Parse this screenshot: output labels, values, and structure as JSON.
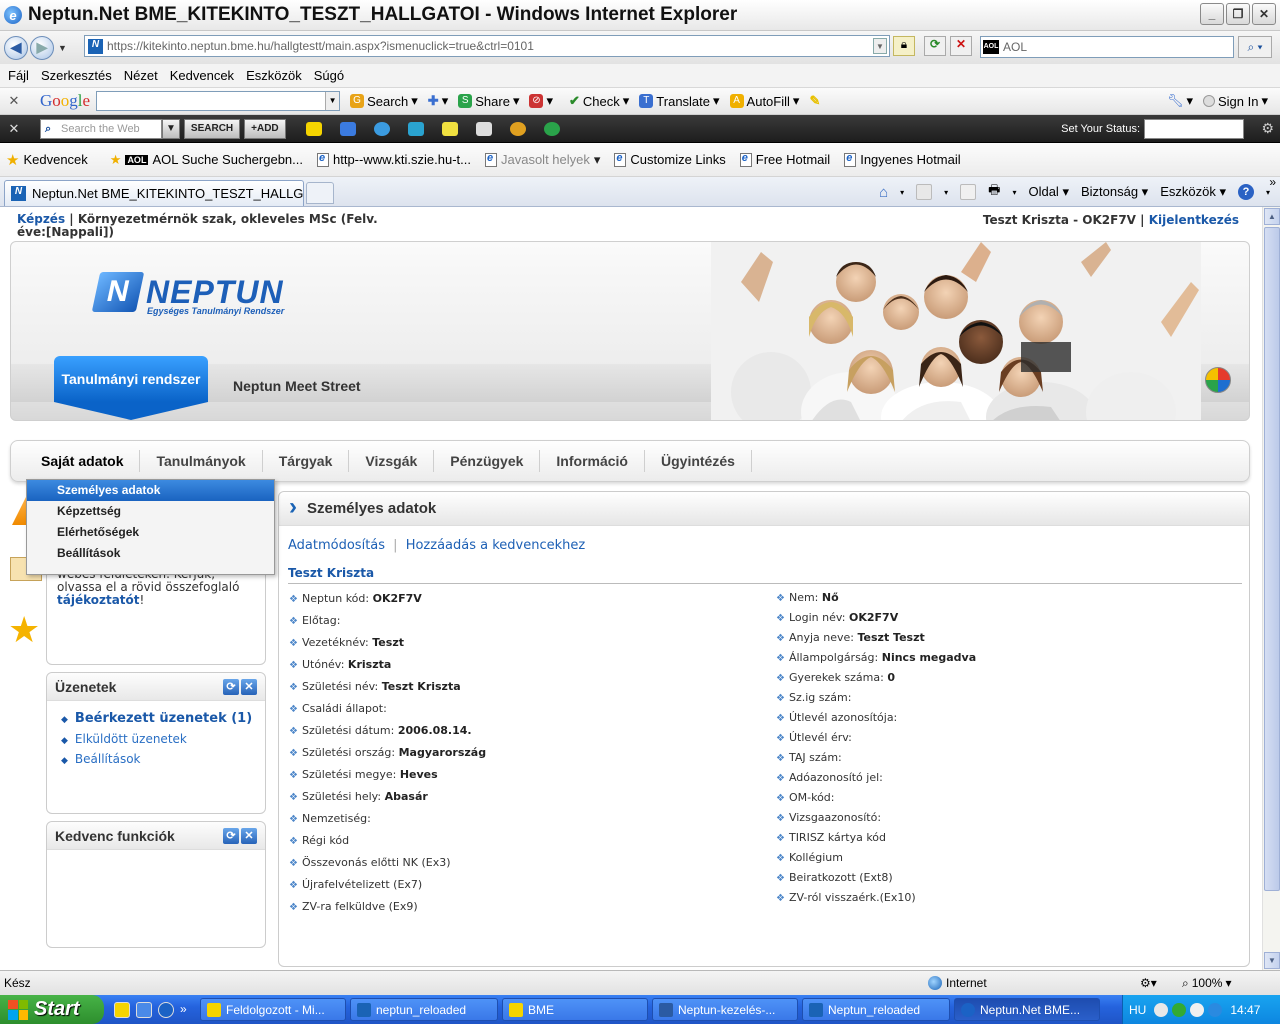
{
  "window": {
    "title": "Neptun.Net BME_KITEKINTO_TESZT_HALLGATOI - Windows Internet Explorer"
  },
  "address": {
    "url": "https://kitekinto.neptun.bme.hu/hallgtestt/main.aspx?ismenuclick=true&ctrl=0101",
    "aol_search": "AOL"
  },
  "menubar": [
    "Fájl",
    "Szerkesztés",
    "Nézet",
    "Kedvencek",
    "Eszközök",
    "Súgó"
  ],
  "google_toolbar": {
    "search": "Search",
    "share": "Share",
    "check": "Check",
    "translate": "Translate",
    "autofill": "AutoFill",
    "signin": "Sign In"
  },
  "aol_toolbar": {
    "placeholder": "Search the Web",
    "search_btn": "SEARCH",
    "add_btn": "+ADD",
    "status_label": "Set Your Status:"
  },
  "favbar": {
    "favorites": "Kedvencek",
    "items": [
      "AOL Suche Suchergebn...",
      "http--www.kti.szie.hu-t...",
      "Javasolt helyek",
      "Customize Links",
      "Free Hotmail",
      "Ingyenes Hotmail"
    ]
  },
  "tab": {
    "label": "Neptun.Net BME_KITEKINTO_TESZT_HALLGA..."
  },
  "cmdbar": {
    "page": "Oldal",
    "safety": "Biztonság",
    "tools": "Eszközök"
  },
  "top": {
    "training": "Képzés",
    "program": "Környezetmérnök szak, okleveles MSc (Felv. éve:[Nappali])",
    "user": "Teszt Kriszta - OK2F7V",
    "logout": "Kijelentkezés"
  },
  "header": {
    "logo_text": "NEPTUN",
    "logo_sub": "Egységes Tanulmányi Rendszer",
    "system_btn": "Tanulmányi rendszer",
    "meet": "Neptun Meet Street"
  },
  "nav": [
    "Saját adatok",
    "Tanulmányok",
    "Tárgyak",
    "Vizsgák",
    "Pénzügyek",
    "Információ",
    "Ügyintézés"
  ],
  "dropdown": [
    "Személyes adatok",
    "Képzettség",
    "Elérhetőségek",
    "Beállítások"
  ],
  "notice": {
    "line1": "webes felületeken. Kérjük,",
    "line2": "olvassa el a rövid összefoglaló",
    "link": "tájékoztatót",
    "tail": "!"
  },
  "messages": {
    "title": "Üzenetek",
    "inbox": "Beérkezett üzenetek (1)",
    "sent": "Elküldött üzenetek",
    "settings": "Beállítások"
  },
  "favfunc": {
    "title": "Kedvenc funkciók"
  },
  "main": {
    "title": "Személyes adatok",
    "action_edit": "Adatmódosítás",
    "action_fav": "Hozzáadás a kedvencekhez",
    "name": "Teszt Kriszta",
    "left": [
      {
        "label": "Neptun kód:",
        "value": "OK2F7V"
      },
      {
        "label": "Előtag:",
        "value": ""
      },
      {
        "label": "Vezetéknév:",
        "value": "Teszt"
      },
      {
        "label": "Utónév:",
        "value": "Kriszta"
      },
      {
        "label": "Születési név:",
        "value": "Teszt Kriszta"
      },
      {
        "label": "Családi állapot:",
        "value": ""
      },
      {
        "label": "Születési dátum:",
        "value": "2006.08.14."
      },
      {
        "label": "Születési ország:",
        "value": "Magyarország"
      },
      {
        "label": "Születési megye:",
        "value": "Heves"
      },
      {
        "label": "Születési hely:",
        "value": "Abasár"
      },
      {
        "label": "Nemzetiség:",
        "value": ""
      },
      {
        "label": "Régi kód",
        "value": ""
      },
      {
        "label": "Összevonás előtti NK (Ex3)",
        "value": ""
      },
      {
        "label": "Újrafelvételizett (Ex7)",
        "value": ""
      },
      {
        "label": "ZV-ra felküldve (Ex9)",
        "value": ""
      }
    ],
    "right": [
      {
        "label": "Nem:",
        "value": "Nő"
      },
      {
        "label": "Login név:",
        "value": "OK2F7V"
      },
      {
        "label": "Anyja neve:",
        "value": "Teszt Teszt"
      },
      {
        "label": "Állampolgárság:",
        "value": "Nincs megadva"
      },
      {
        "label": "Gyerekek száma:",
        "value": "0"
      },
      {
        "label": "Sz.ig szám:",
        "value": ""
      },
      {
        "label": "Útlevél azonosítója:",
        "value": ""
      },
      {
        "label": "Útlevél érv:",
        "value": ""
      },
      {
        "label": "TAJ szám:",
        "value": ""
      },
      {
        "label": "Adóazonosító jel:",
        "value": ""
      },
      {
        "label": "OM-kód:",
        "value": ""
      },
      {
        "label": "Vizsgaazonosító:",
        "value": ""
      },
      {
        "label": "TIRISZ kártya kód",
        "value": ""
      },
      {
        "label": "Kollégium",
        "value": ""
      },
      {
        "label": "Beiratkozott (Ext8)",
        "value": ""
      },
      {
        "label": "ZV-ról visszaérk.(Ex10)",
        "value": ""
      }
    ]
  },
  "statusbar": {
    "ready": "Kész",
    "zone": "Internet",
    "zoom": "100%"
  },
  "taskbar": {
    "start": "Start",
    "tasks": [
      "Feldolgozott - Mi...",
      "neptun_reloaded",
      "BME",
      "Neptun-kezelés-...",
      "Neptun_reloaded",
      "Neptun.Net BME..."
    ],
    "lang": "HU",
    "time": "14:47"
  }
}
